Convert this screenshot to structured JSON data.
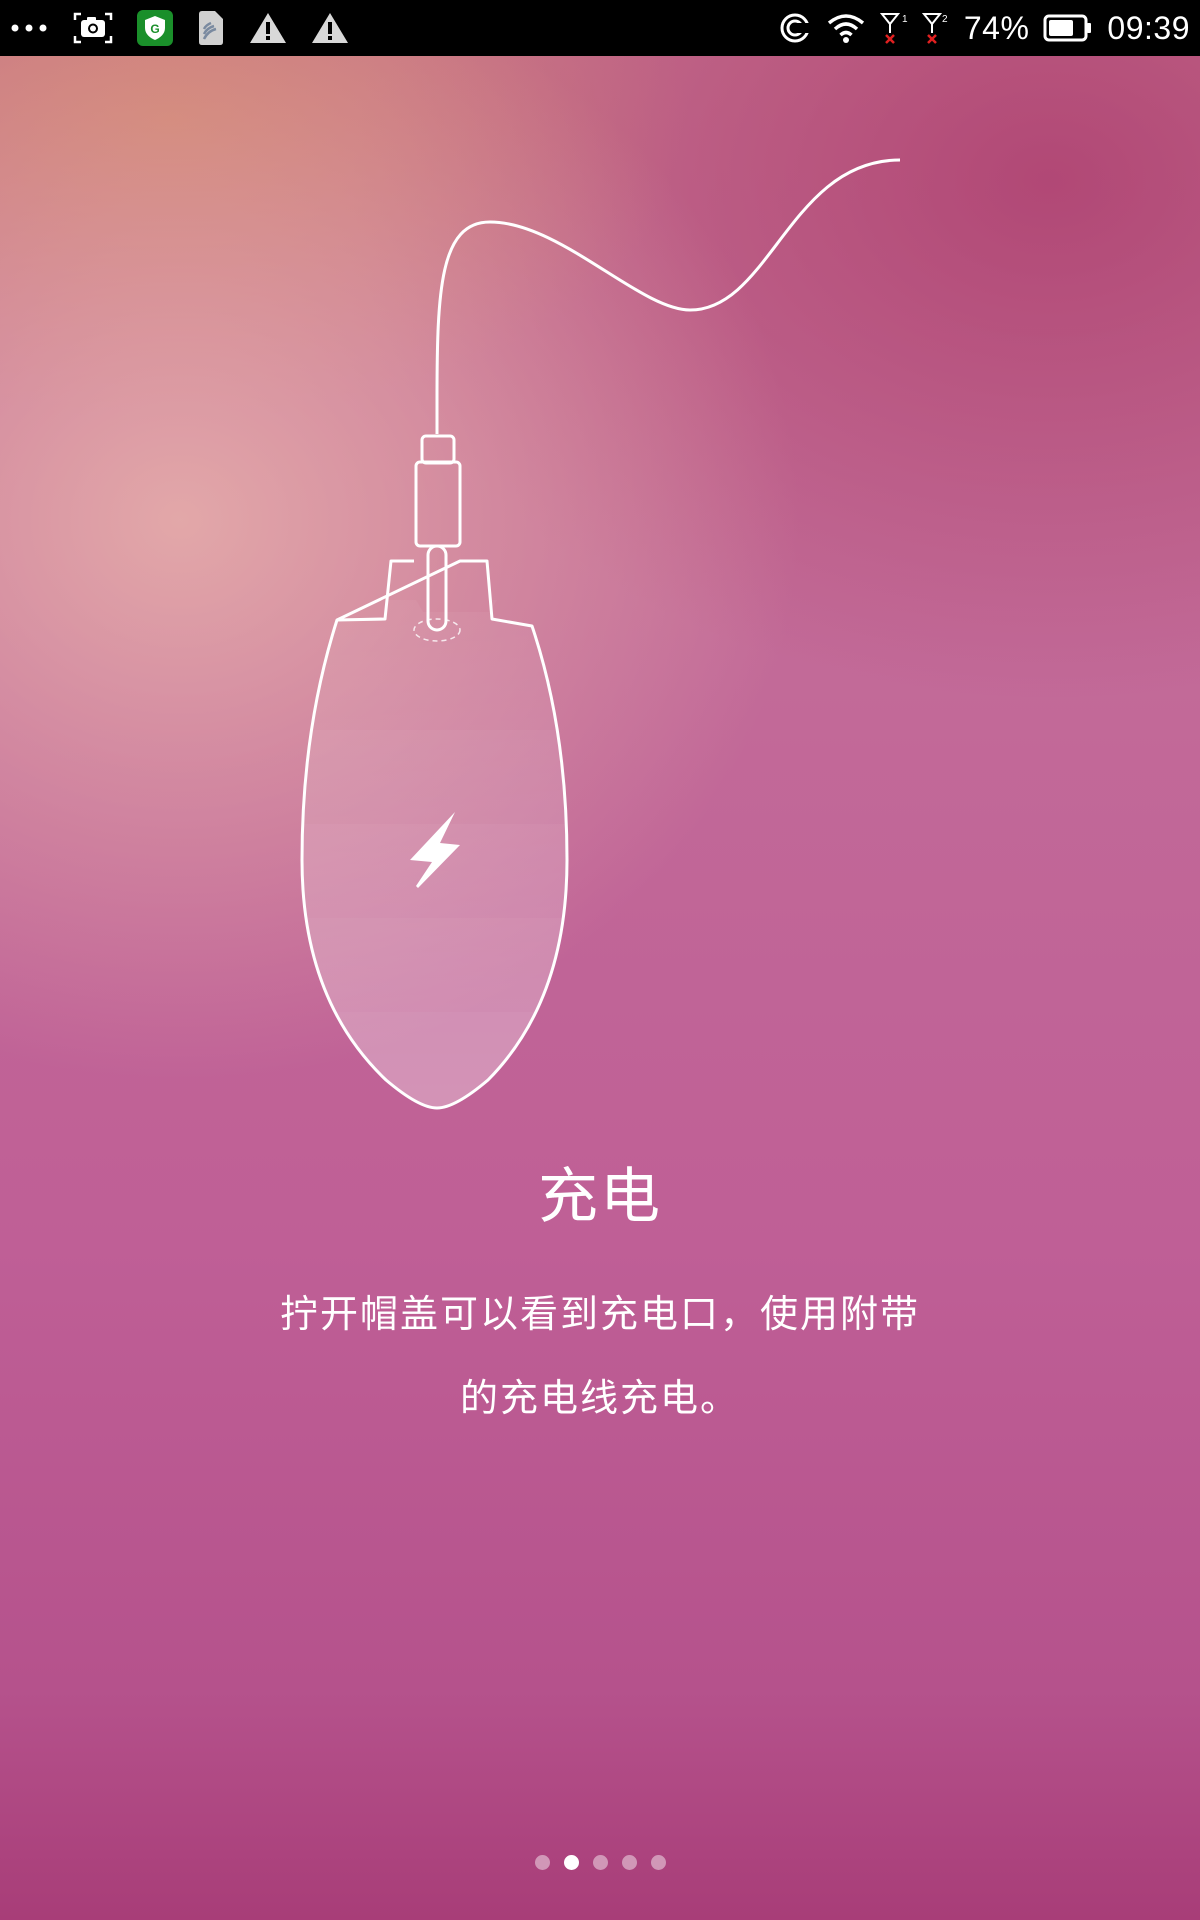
{
  "status_bar": {
    "left_icons": [
      "more-dots-icon",
      "screenshot-icon",
      "security-app-icon",
      "sim-card-icon",
      "warning-icon",
      "warning-icon"
    ],
    "right_icons": [
      "sync-icon",
      "wifi-icon",
      "sim1-no-signal-icon",
      "sim2-no-signal-icon",
      "battery-icon"
    ],
    "battery_percent": "74%",
    "battery_level": 0.74,
    "time": "09:39"
  },
  "illustration": {
    "subject": "mouse-charging-illustration",
    "icon": "lightning-bolt-icon",
    "colors": {
      "line": "#ffffff"
    }
  },
  "content": {
    "title": "充电",
    "description": "拧开帽盖可以看到充电口，使用附带的充电线充电。"
  },
  "pager": {
    "total": 5,
    "active_index": 1
  },
  "colors": {
    "background_top": "#c7738f",
    "background_bottom": "#a83d78",
    "status_bar": "#000000",
    "text": "#ffffff"
  }
}
